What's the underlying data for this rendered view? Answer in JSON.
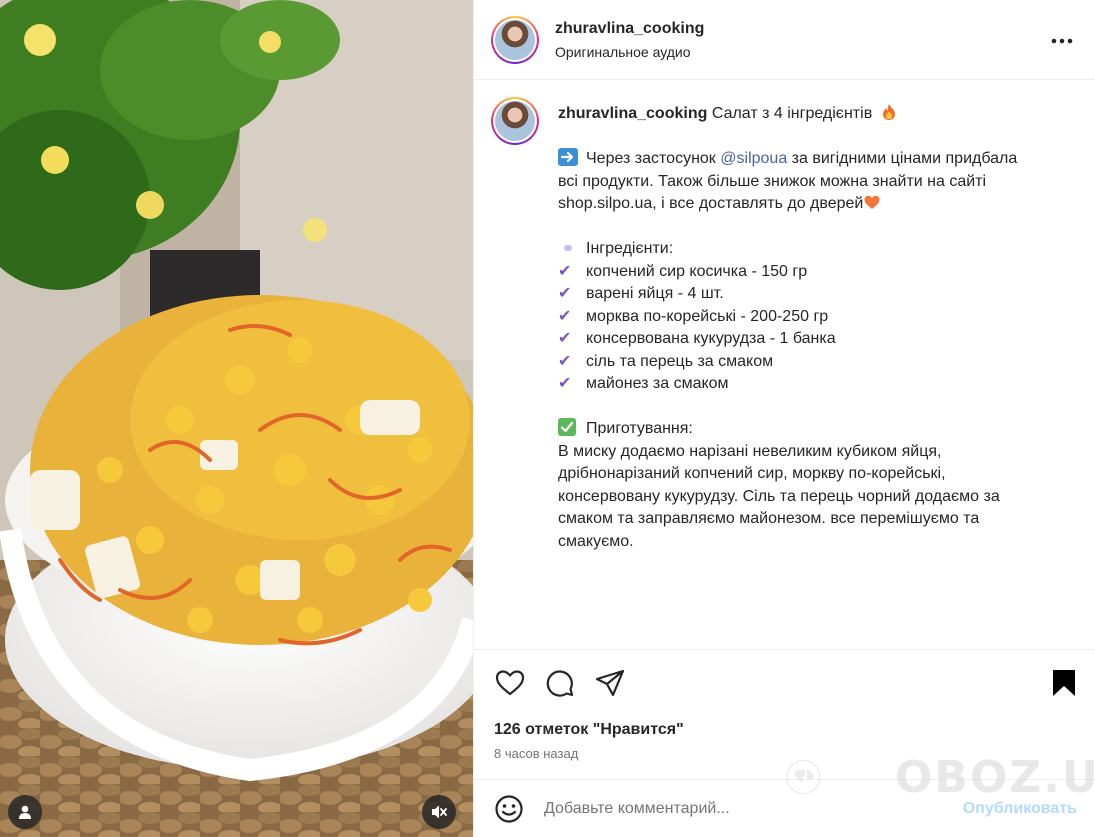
{
  "header": {
    "username": "zhuravlina_cooking",
    "audio": "Оригинальное аудио",
    "more_icon": "more-horizontal-icon"
  },
  "caption": {
    "username": "zhuravlina_cooking",
    "title": "Салат з 4 інгредієнтів",
    "intro_arrow": "➡️",
    "intro_before": "Через застосунок",
    "mention": "@silpoua",
    "intro_after": "за вигідними цінами придбала",
    "intro_line2": "всі продукти. Також більше знижок можна знайти на сайті",
    "intro_line3": "shop.silpo.ua, і все доставлять до дверей",
    "ingredients_heading": "Інгредієнти:",
    "ingredients": [
      "копчений сир косичка - 150 гр",
      "варені яйця - 4 шт.",
      "морква по-корейські - 200-250 гр",
      "консервована кукурудза - 1 банка",
      "сіль та перець за смаком",
      "майонез за смаком"
    ],
    "prep_heading": "Приготування:",
    "prep_lines": [
      "В миску додаємо нарізані невеликим кубиком яйця,",
      "дрібнонарізаний копчений сир, моркву по-корейські,",
      "консервовану кукурудзу. Сіль та перець чорний додаємо за",
      "смаком та заправляємо майонезом. все перемішуємо та",
      "смакуємо."
    ]
  },
  "stats": {
    "likes": "126 отметок \"Нравится\"",
    "time": "8 часов назад"
  },
  "comment": {
    "placeholder": "Добавьте комментарий...",
    "publish": "Опубликовать"
  },
  "watermark": {
    "text": "OBOZ.UA"
  },
  "colors": {
    "accent_check": "#7d55c7",
    "publish_disabled": "#b3dbff",
    "mention": "#4a63a8"
  }
}
